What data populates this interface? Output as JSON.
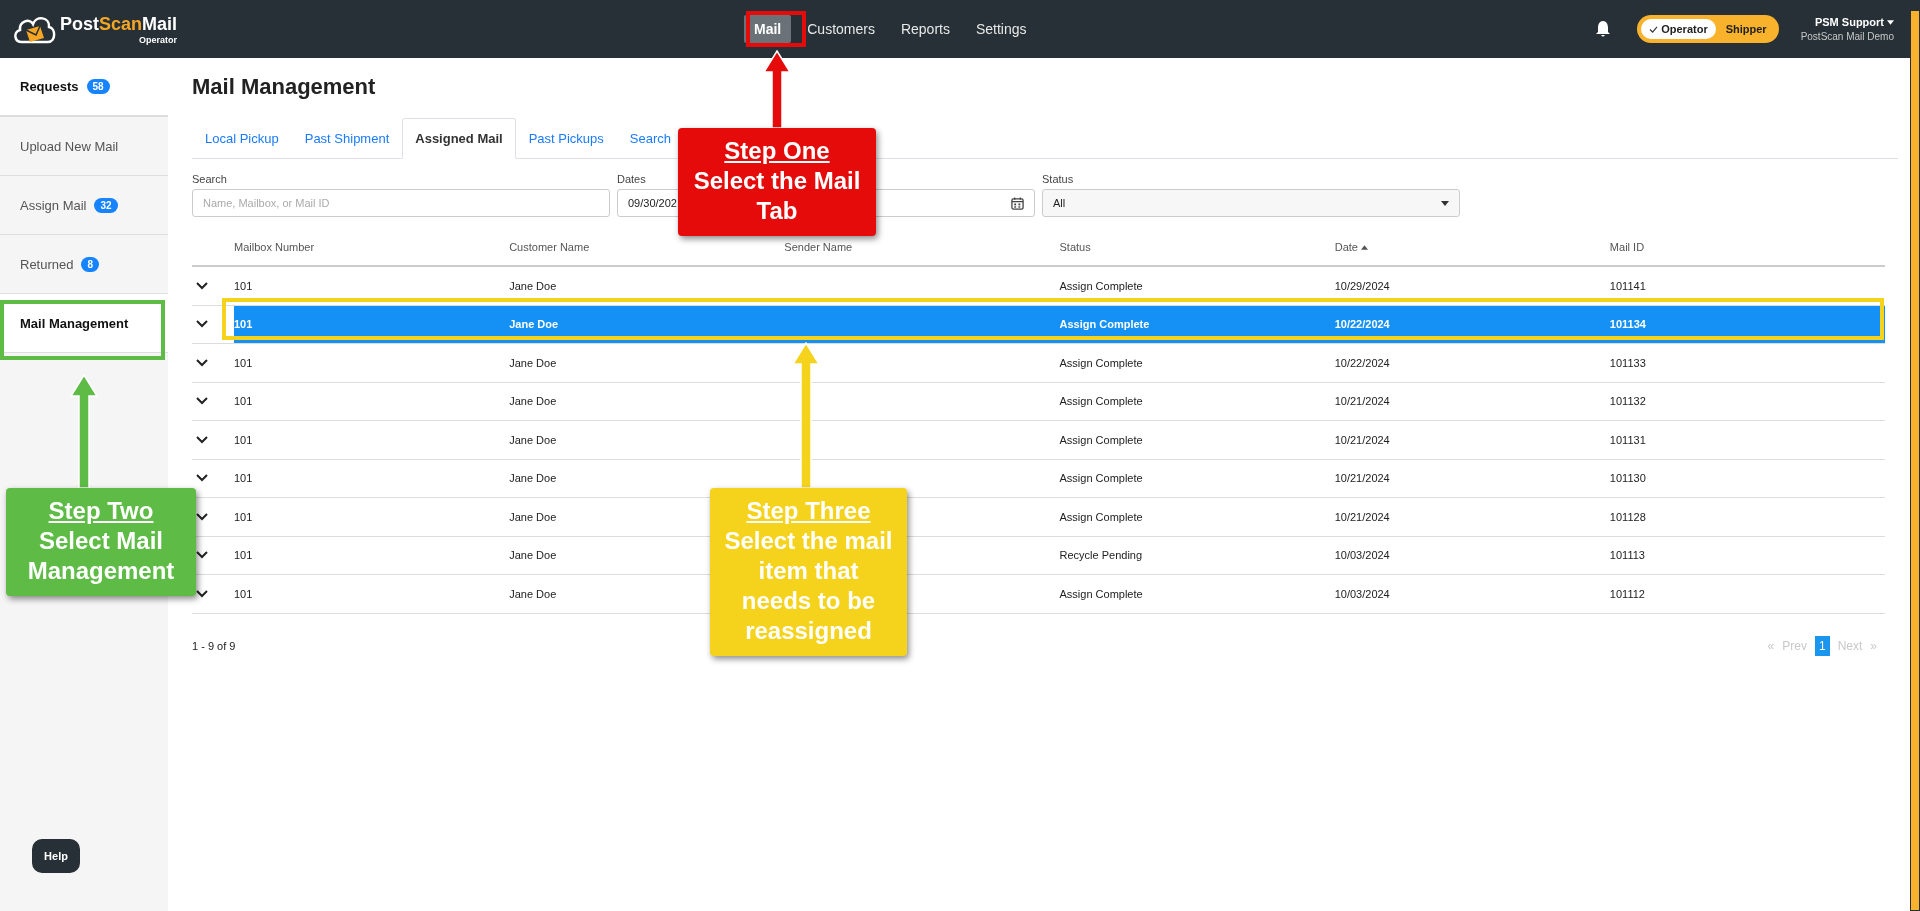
{
  "brand": {
    "name_left": "Post",
    "name_mid": "Scan",
    "name_right": "Mail",
    "subtitle": "Operator"
  },
  "nav": [
    {
      "label": "Mail",
      "selected": true
    },
    {
      "label": "Customers",
      "selected": false
    },
    {
      "label": "Reports",
      "selected": false
    },
    {
      "label": "Settings",
      "selected": false
    }
  ],
  "roles": [
    {
      "label": "Operator",
      "selected": true
    },
    {
      "label": "Shipper",
      "selected": false
    }
  ],
  "user": {
    "name": "PSM Support",
    "org": "PostScan Mail Demo"
  },
  "sidebar": {
    "items": [
      {
        "label": "Requests",
        "badge": "58",
        "bold": true
      },
      {
        "label": "Upload New Mail",
        "bold": false
      },
      {
        "label": "Assign Mail",
        "badge": "32",
        "bold": false
      },
      {
        "label": "Returned",
        "badge": "8",
        "bold": false
      },
      {
        "label": "Mail Management",
        "bold": true
      }
    ],
    "help": "Help"
  },
  "page_title": "Mail Management",
  "tabs": [
    {
      "label": "Local Pickup",
      "selected": false
    },
    {
      "label": "Past Shipment",
      "selected": false
    },
    {
      "label": "Assigned Mail",
      "selected": true
    },
    {
      "label": "Past Pickups",
      "selected": false
    },
    {
      "label": "Search",
      "selected": false
    }
  ],
  "filters": {
    "search": {
      "label": "Search",
      "placeholder": "Name, Mailbox, or Mail ID"
    },
    "dates": {
      "label": "Dates",
      "value": "09/30/202"
    },
    "status": {
      "label": "Status",
      "value": "All"
    }
  },
  "table": {
    "columns": [
      {
        "label": "Mailbox Number",
        "sorted": false
      },
      {
        "label": "Customer Name",
        "sorted": false
      },
      {
        "label": "Sender Name",
        "sorted": false
      },
      {
        "label": "Status",
        "sorted": false
      },
      {
        "label": "Date",
        "sorted": true
      },
      {
        "label": "Mail ID",
        "sorted": false
      }
    ],
    "rows": [
      {
        "cells": [
          "101",
          "Jane Doe",
          "",
          "Assign Complete",
          "10/29/2024",
          "101141"
        ],
        "selected": false
      },
      {
        "cells": [
          "101",
          "Jane Doe",
          "",
          "Assign Complete",
          "10/22/2024",
          "101134"
        ],
        "selected": true
      },
      {
        "cells": [
          "101",
          "Jane Doe",
          "",
          "Assign Complete",
          "10/22/2024",
          "101133"
        ],
        "selected": false
      },
      {
        "cells": [
          "101",
          "Jane Doe",
          "",
          "Assign Complete",
          "10/21/2024",
          "101132"
        ],
        "selected": false
      },
      {
        "cells": [
          "101",
          "Jane Doe",
          "",
          "Assign Complete",
          "10/21/2024",
          "101131"
        ],
        "selected": false
      },
      {
        "cells": [
          "101",
          "Jane Doe",
          "",
          "Assign Complete",
          "10/21/2024",
          "101130"
        ],
        "selected": false
      },
      {
        "cells": [
          "101",
          "Jane Doe",
          "",
          "Assign Complete",
          "10/21/2024",
          "101128"
        ],
        "selected": false
      },
      {
        "cells": [
          "101",
          "Jane Doe",
          "",
          "Recycle Pending",
          "10/03/2024",
          "101113"
        ],
        "selected": false
      },
      {
        "cells": [
          "101",
          "Jane Doe",
          "",
          "Assign Complete",
          "10/03/2024",
          "101112"
        ],
        "selected": false
      }
    ]
  },
  "pagination": {
    "summary": "1 - 9 of 9",
    "first": "«",
    "prev": "Prev",
    "pages": [
      {
        "label": "1",
        "selected": true
      }
    ],
    "next": "Next",
    "last": "»"
  },
  "annotations": [
    {
      "title": "Step One",
      "text": "Select the Mail Tab",
      "color": "#e60b0b"
    },
    {
      "title": "Step Two",
      "text": "Select Mail Management",
      "color": "#5dbb46"
    },
    {
      "title": "Step Three",
      "text": "Select the mail item that needs to be reassigned",
      "color": "#f5d31c"
    }
  ]
}
